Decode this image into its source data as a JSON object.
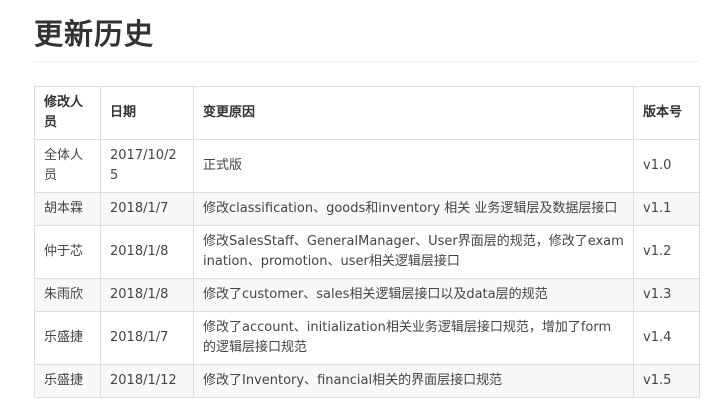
{
  "page": {
    "title": "更新历史"
  },
  "table": {
    "headers": [
      "修改人员",
      "日期",
      "变更原因",
      "版本号"
    ],
    "rows": [
      {
        "author": "全体人员",
        "date": "2017/10/25",
        "reason": "正式版",
        "version": "v1.0"
      },
      {
        "author": "胡本霖",
        "date": "2018/1/7",
        "reason": "修改classification、goods和inventory 相关 业务逻辑层及数据层接口",
        "version": "v1.1"
      },
      {
        "author": "仲于芯",
        "date": "2018/1/8",
        "reason": "修改SalesStaff、GeneralManager、User界面层的规范，修改了examination、promotion、user相关逻辑层接口",
        "version": "v1.2"
      },
      {
        "author": "朱雨欣",
        "date": "2018/1/8",
        "reason": "修改了customer、sales相关逻辑层接口以及data层的规范",
        "version": "v1.3"
      },
      {
        "author": "乐盛捷",
        "date": "2018/1/7",
        "reason": "修改了account、initialization相关业务逻辑层接口规范，增加了form的逻辑层接口规范",
        "version": "v1.4"
      },
      {
        "author": "乐盛捷",
        "date": "2018/1/12",
        "reason": "修改了Inventory、financial相关的界面层接口规范",
        "version": "v1.5"
      }
    ]
  }
}
